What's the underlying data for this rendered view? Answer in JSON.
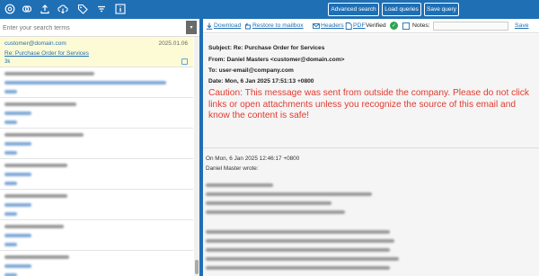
{
  "toolbar": {
    "icons": [
      "at-sign-icon",
      "link-icon",
      "upload-icon",
      "cloud-download-icon",
      "tag-icon",
      "filter-icon",
      "info-icon"
    ],
    "buttons": {
      "advanced_search": "Advanced search",
      "load_queries": "Load queries",
      "save_query": "Save query"
    },
    "accent_color": "#1f6fb5"
  },
  "search": {
    "placeholder": "Enter your search terms"
  },
  "messages": [
    {
      "from": "customer@domain.com",
      "date": "2025.01.06",
      "subject": "Re: Purchase Order for Services",
      "size": "3k",
      "selected": true
    }
  ],
  "viewer": {
    "actions": {
      "download": "Download",
      "restore": "Restore to mailbox",
      "headers": "Headers",
      "pdf": "PDF",
      "verified": "Verified",
      "notes": "Notes:",
      "save": "Save"
    },
    "headers": {
      "subject": "Subject: Re: Purchase Order for Services",
      "from": "From: Daniel Masters <customer@domain.com>",
      "to": "To: user-email@company.com",
      "date": "Date: Mon, 6 Jan 2025 17:51:13 +0800"
    },
    "caution": "Caution: This message was sent from outside the company. Please do not click links or open attachments unless you recognize the source of this email and know the content is safe!",
    "body": {
      "quote_header": "On Mon, 6 Jan 2025 12:46:17 +0800",
      "wrote": "Daniel Master wrote:"
    }
  }
}
